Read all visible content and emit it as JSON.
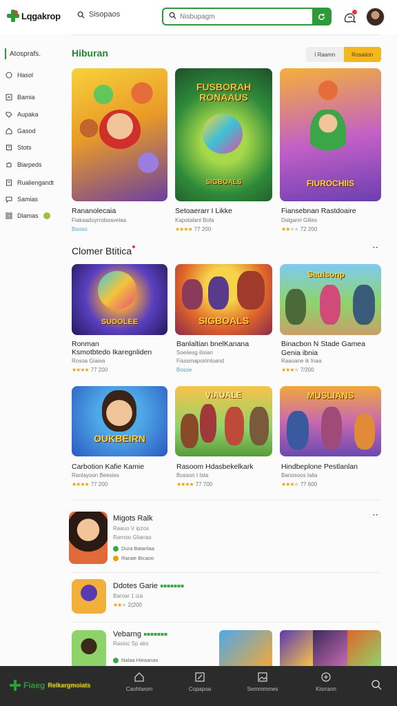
{
  "header": {
    "logo_text": "Lqgakrop",
    "nav_search_label": "Sisopaos",
    "search_placeholder": "Nisbupagm",
    "notification_icon": "chat-bell-icon",
    "avatar_icon": "user-avatar"
  },
  "sidebar": {
    "active": "Atosprafs.",
    "items": [
      "Hasol",
      "Bamia",
      "Aupaka",
      "Gasod",
      "Stots",
      "Blarpeds",
      "Rualiengandt",
      "Samias",
      "Dlamas"
    ]
  },
  "colors": {
    "accent": "#2e9a3a",
    "star": "#e9a300",
    "toggle_active": "#f4b81c",
    "nav_bg": "#2b2b2b"
  },
  "section1": {
    "title": "Hiburan",
    "toggle": [
      "I Raamn",
      "Rosaiion"
    ],
    "cards": [
      {
        "title": "Rananolecaia",
        "sub": "Fiakaaduyrroboavelaa",
        "meta": "Booso"
      },
      {
        "title": "Setoaerarr I Likke",
        "sub": "Kapotalanl Bofa",
        "rating": "77 200"
      },
      {
        "title": "Fiansebnan Rastdoaire",
        "sub": "Dalganri Gliles",
        "rating": "72 200"
      }
    ],
    "art_text": [
      "",
      "FUSBORAH RONAAUS",
      "FIUROCHIIS"
    ]
  },
  "section2": {
    "title": "Clomer Btitica",
    "cards": [
      {
        "title": "Ronman",
        "title2": "Ksmotbtedo Ikaregnliden",
        "sub": "Rosoa Giaiea",
        "rating": "77 200"
      },
      {
        "title": "Banlaltian bnelKanana",
        "sub": "Soeiiesg ilisian",
        "sub2": "Fisssmapoirinloand",
        "meta": "Bosse"
      },
      {
        "title": "Binacbon N Stade Gamea",
        "title2": "Genia ibnia",
        "sub": "Raaoane ik Inaa",
        "rating": "7/200"
      },
      {
        "title": "Carbotion Kafie Kamie",
        "sub": "Ranlayoon Beesies",
        "rating": "77 200"
      },
      {
        "title": "Rasoom Hdasbekelkark",
        "sub": "Busson I Ista",
        "rating": "77 700"
      },
      {
        "title": "Hindbeplone Pestlanlan",
        "sub": "Banosoos Ialia",
        "rating": "77 600"
      }
    ],
    "art_text": [
      "SUDOLEE",
      "SIGBOALS",
      "Saulsonp",
      "OUKBEIRN",
      "VIAUALE",
      "MUSLIANS"
    ]
  },
  "list": [
    {
      "name": "Migots Ralk",
      "sub1": "Raauo V ipzos",
      "sub2": "Rarnoo Glianas",
      "meta1": "Dura Batanlaa",
      "meta2": "Raraie Bicaoo"
    },
    {
      "name": "Ddotes Garie",
      "sub1": "Baroar 1 iza",
      "rating": "2(200"
    },
    {
      "name": "Vebarng",
      "sub1": "Rasioc Sp abs",
      "meta1": "Nalaa Hieaanas"
    }
  ],
  "bottom_nav": {
    "brand": "Fiaeg",
    "brand_sub": "Relkargmoiats",
    "items": [
      "Caohtwom",
      "Copapoa",
      "Semmmmes",
      "Kisrrann"
    ]
  }
}
